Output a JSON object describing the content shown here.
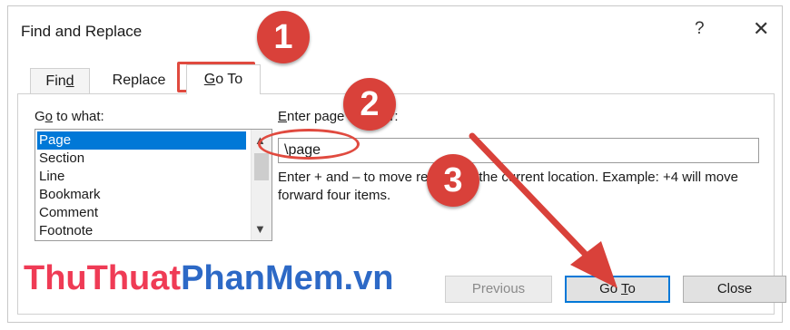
{
  "window": {
    "title": "Find and Replace",
    "help_glyph": "?",
    "close_glyph": "✕"
  },
  "tabs": [
    {
      "label_underlined": "",
      "label_rest_pre": "Fin",
      "label_u": "d",
      "label_rest_post": ""
    },
    {
      "label": "Replace"
    },
    {
      "label_u": "G",
      "label_rest": "o To"
    }
  ],
  "goto_what": {
    "label_u": "o",
    "label_pre": "G",
    "label_post": " to what:",
    "items": [
      "Page",
      "Section",
      "Line",
      "Bookmark",
      "Comment",
      "Footnote"
    ],
    "selected": "Page"
  },
  "page_number": {
    "label_u": "E",
    "label_rest": "nter page number:",
    "value": "\\page"
  },
  "hint_text": "Enter + and – to move relative to the current location. Example: +4 will move forward four items.",
  "buttons": {
    "previous": "Previous",
    "goto_pre": "Go ",
    "goto_u": "T",
    "goto_post": "o",
    "close": "Close"
  },
  "annotations": {
    "step1": "1",
    "step2": "2",
    "step3": "3",
    "color": "#d9413a"
  },
  "watermark": {
    "part1": "ThuThuat",
    "part2": "PhanMem.vn"
  },
  "colors": {
    "selection": "#0078d7",
    "default_button_border": "#0078d7"
  }
}
